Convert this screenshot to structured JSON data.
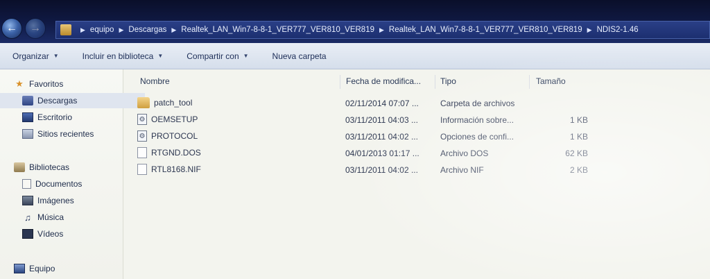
{
  "address_bar": {
    "crumbs": [
      "equipo",
      "Descargas",
      "Realtek_LAN_Win7-8-8-1_VER777_VER810_VER819",
      "Realtek_LAN_Win7-8-8-1_VER777_VER810_VER819",
      "NDIS2-1.46"
    ]
  },
  "toolbar": {
    "organize": "Organizar",
    "include_library": "Incluir en biblioteca",
    "share_with": "Compartir con",
    "new_folder": "Nueva carpeta"
  },
  "navigation": {
    "favorites": {
      "label": "Favoritos",
      "items": [
        "Descargas",
        "Escritorio",
        "Sitios recientes"
      ]
    },
    "libraries": {
      "label": "Bibliotecas",
      "items": [
        "Documentos",
        "Imágenes",
        "Música",
        "Vídeos"
      ]
    },
    "computer": "Equipo"
  },
  "columns": {
    "name": "Nombre",
    "date": "Fecha de modifica...",
    "type": "Tipo",
    "size": "Tamaño"
  },
  "files": [
    {
      "name": "patch_tool",
      "date": "02/11/2014 07:07 ...",
      "type": "Carpeta de archivos",
      "size": "",
      "icon": "folder-icon"
    },
    {
      "name": "OEMSETUP",
      "date": "03/11/2011 04:03 ...",
      "type": "Información sobre...",
      "size": "1 KB",
      "icon": "settings-file-icon"
    },
    {
      "name": "PROTOCOL",
      "date": "03/11/2011 04:02 ...",
      "type": "Opciones de confi...",
      "size": "1 KB",
      "icon": "settings-file-icon"
    },
    {
      "name": "RTGND.DOS",
      "date": "04/01/2013 01:17 ...",
      "type": "Archivo DOS",
      "size": "62 KB",
      "icon": "file-icon"
    },
    {
      "name": "RTL8168.NIF",
      "date": "03/11/2011 04:02 ...",
      "type": "Archivo NIF",
      "size": "2 KB",
      "icon": "file-icon"
    }
  ]
}
